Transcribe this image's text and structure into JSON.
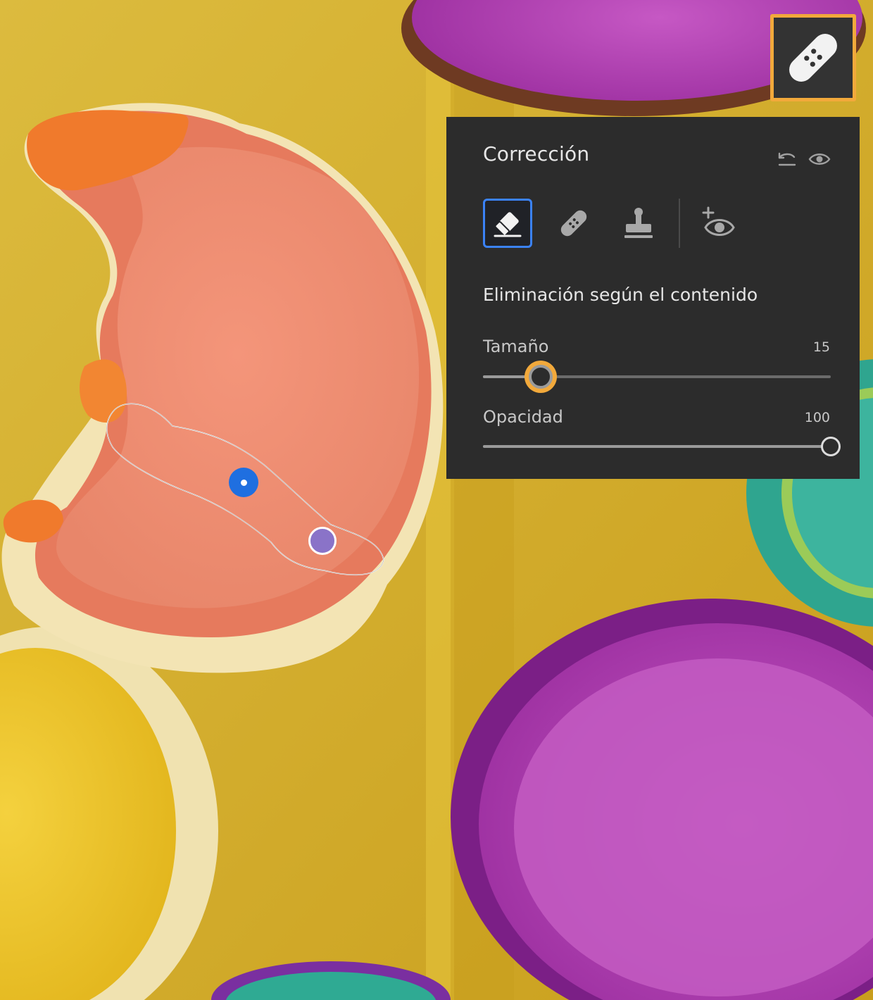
{
  "panel": {
    "title": "Corrección",
    "mode_label": "Eliminación según el contenido",
    "tools": [
      {
        "name": "content-aware-remove",
        "icon": "eraser-icon",
        "active": true
      },
      {
        "name": "heal",
        "icon": "bandage-icon",
        "active": false
      },
      {
        "name": "clone",
        "icon": "clone-stamp-icon",
        "active": false
      },
      {
        "name": "red-eye",
        "icon": "red-eye-icon",
        "active": false
      }
    ],
    "sliders": {
      "size": {
        "label": "Tamaño",
        "value": "15",
        "fraction": 0.167
      },
      "opacity": {
        "label": "Opacidad",
        "value": "100",
        "fraction": 1.0
      }
    }
  },
  "colors": {
    "accent_highlight": "#f2a93b",
    "active_tool_border": "#3b82f6",
    "panel_bg": "#2c2c2c",
    "source_pin": "#1f6fe0",
    "target_pin": "#8a73c8"
  }
}
